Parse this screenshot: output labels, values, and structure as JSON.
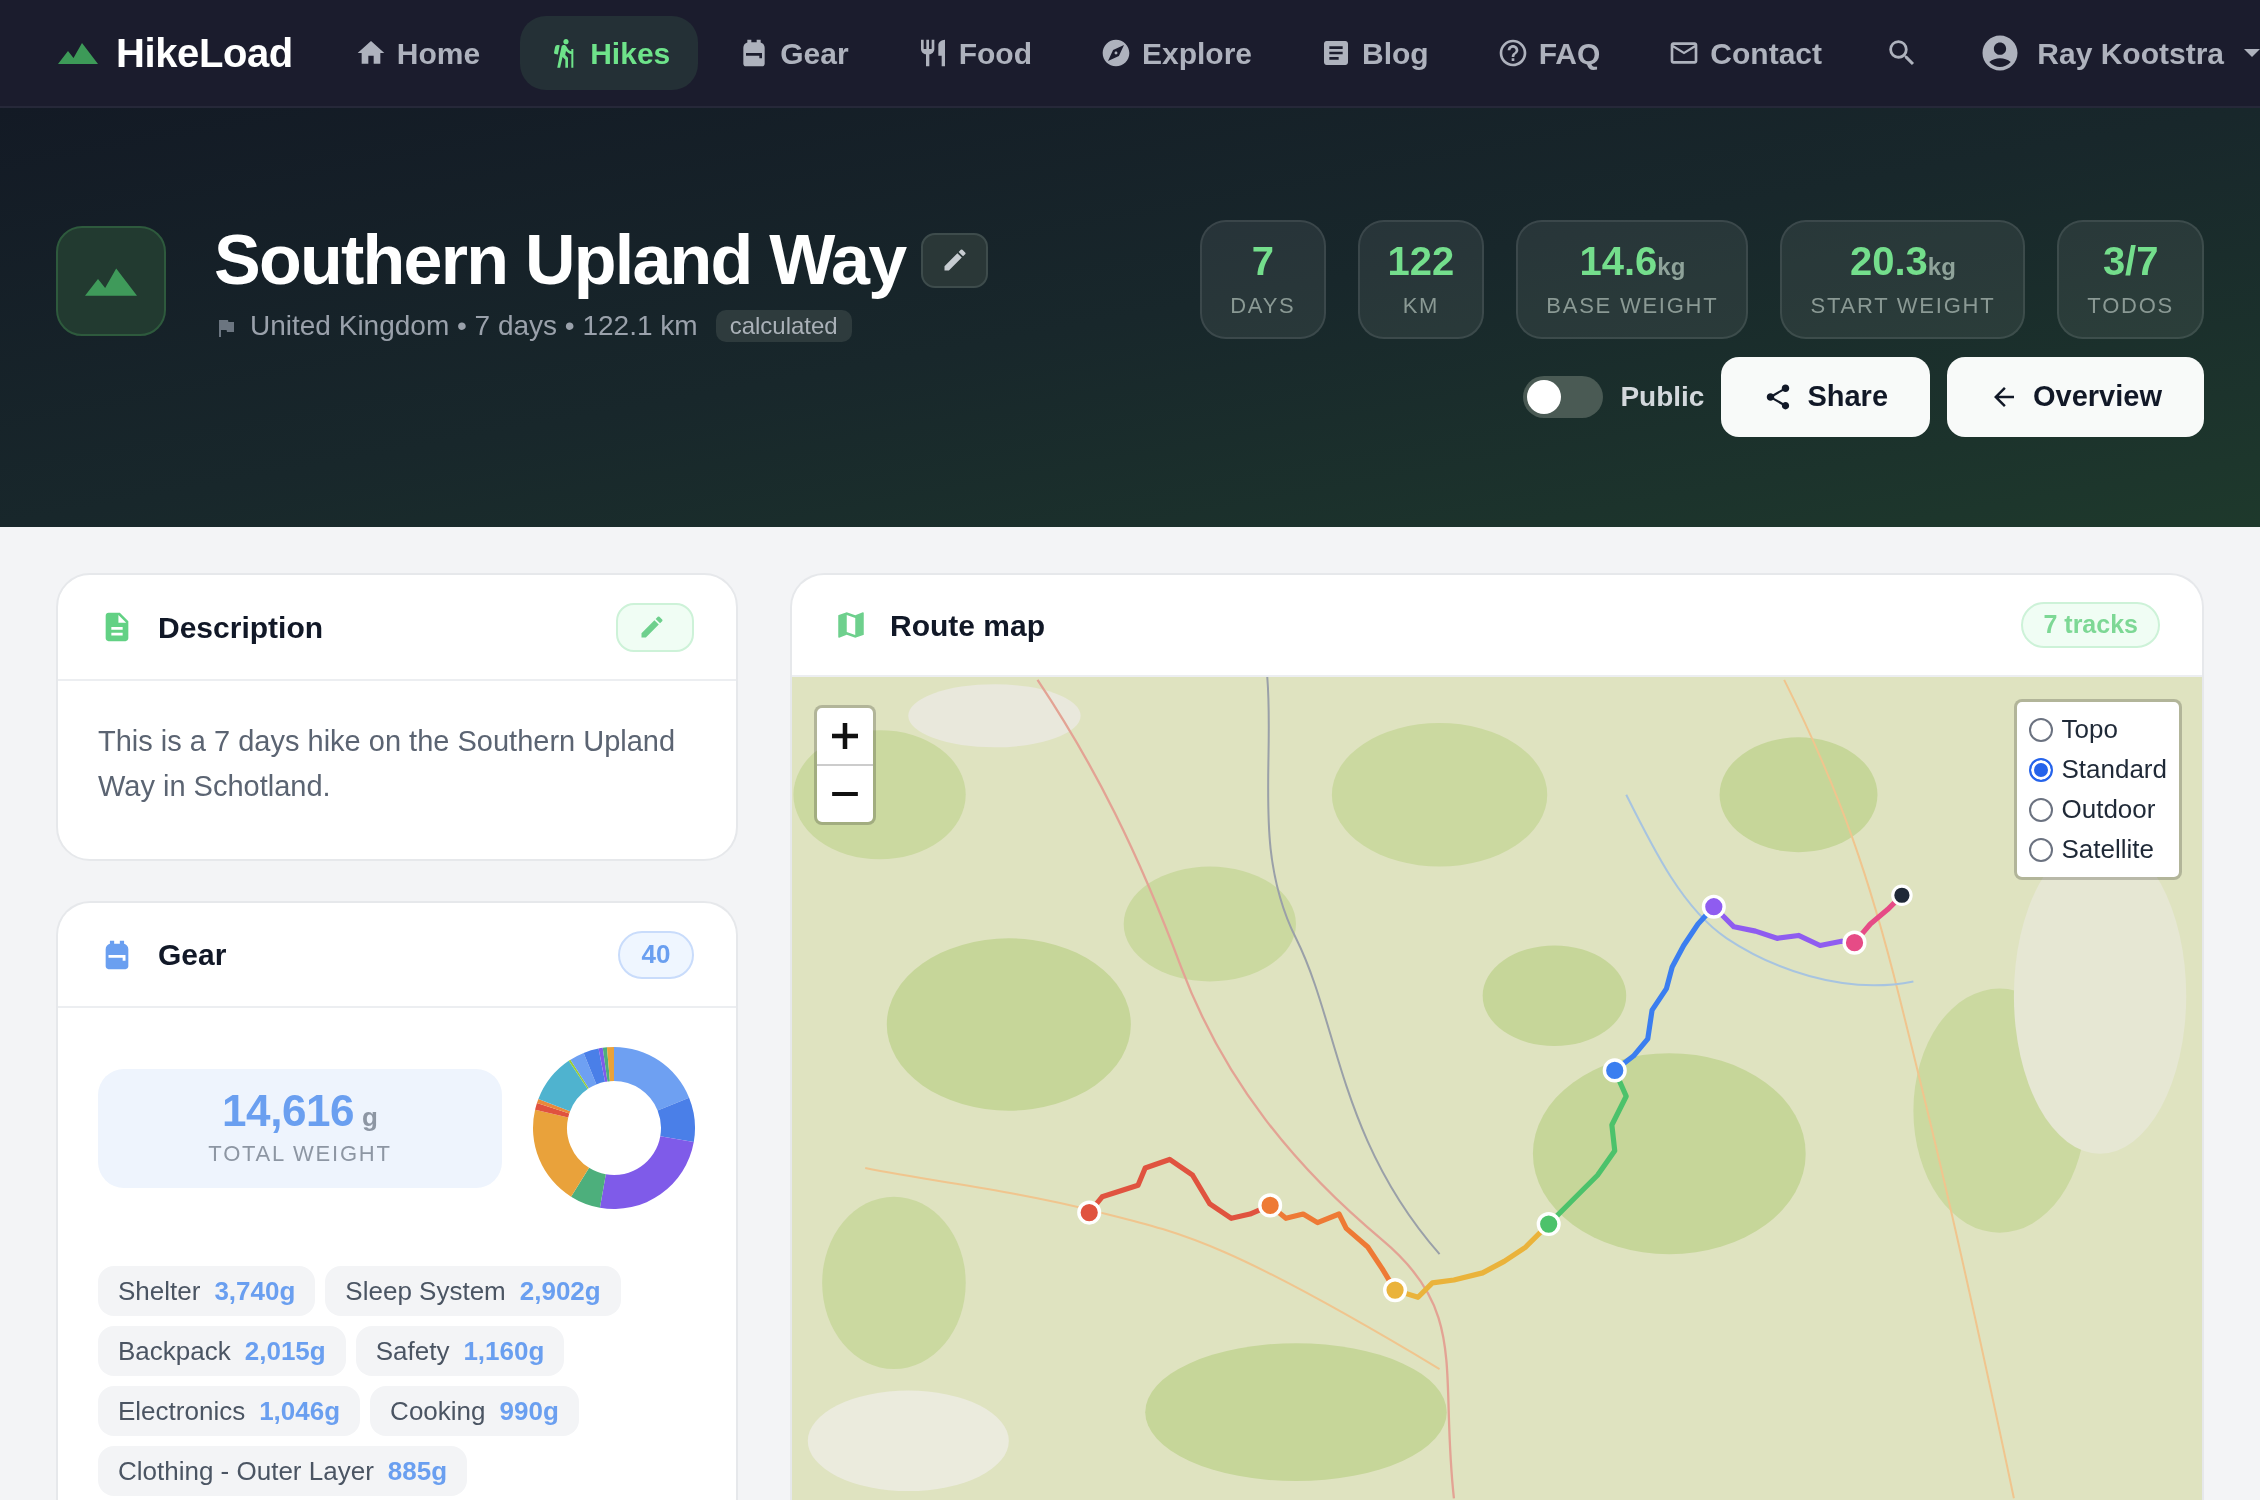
{
  "nav": {
    "logo": "HikeLoad",
    "items": [
      {
        "label": "Home",
        "selected": false
      },
      {
        "label": "Hikes",
        "selected": true
      },
      {
        "label": "Gear",
        "selected": false
      },
      {
        "label": "Food",
        "selected": false
      },
      {
        "label": "Explore",
        "selected": false
      },
      {
        "label": "Blog",
        "selected": false
      },
      {
        "label": "FAQ",
        "selected": false
      },
      {
        "label": "Contact",
        "selected": false
      }
    ],
    "user": "Ray Kootstra"
  },
  "hike": {
    "title": "Southern Upland Way",
    "meta": "United Kingdom • 7 days • 122.1 km",
    "badge": "calculated",
    "stats": [
      {
        "value": "7",
        "label": "DAYS"
      },
      {
        "value": "122",
        "label": "KM"
      },
      {
        "value": "14.6",
        "unit": "kg",
        "label": "BASE WEIGHT"
      },
      {
        "value": "20.3",
        "unit": "kg",
        "label": "START WEIGHT"
      },
      {
        "value": "3/7",
        "label": "TODOS"
      }
    ],
    "public": {
      "label": "Public",
      "on": false
    },
    "buttons": [
      "Share",
      "Overview"
    ]
  },
  "description": {
    "title": "Description",
    "text": "This is a 7 days hike on the Southern Upland Way in Schotland."
  },
  "gear": {
    "title": "Gear",
    "count": "40",
    "total": {
      "value": "14,616",
      "unit": "g",
      "label": "TOTAL WEIGHT"
    },
    "categories": [
      {
        "name": "Shelter",
        "weight": "3,740g"
      },
      {
        "name": "Sleep System",
        "weight": "2,902g"
      },
      {
        "name": "Backpack",
        "weight": "2,015g"
      },
      {
        "name": "Safety",
        "weight": "1,160g"
      },
      {
        "name": "Electronics",
        "weight": "1,046g"
      },
      {
        "name": "Cooking",
        "weight": "990g"
      },
      {
        "name": "Clothing - Outer Layer",
        "weight": "885g"
      }
    ]
  },
  "route_map": {
    "title": "Route map",
    "badge": "7 tracks",
    "layers": [
      {
        "label": "Topo",
        "selected": false
      },
      {
        "label": "Standard",
        "selected": true
      },
      {
        "label": "Outdoor",
        "selected": false
      },
      {
        "label": "Satellite",
        "selected": false
      }
    ],
    "tracks": [
      {
        "color": "#e0533f"
      },
      {
        "color": "#ee7a35"
      },
      {
        "color": "#eab33b"
      },
      {
        "color": "#4cc26b"
      },
      {
        "color": "#3b7ef0"
      },
      {
        "color": "#8f5cf0"
      },
      {
        "color": "#e64b86"
      }
    ]
  }
}
